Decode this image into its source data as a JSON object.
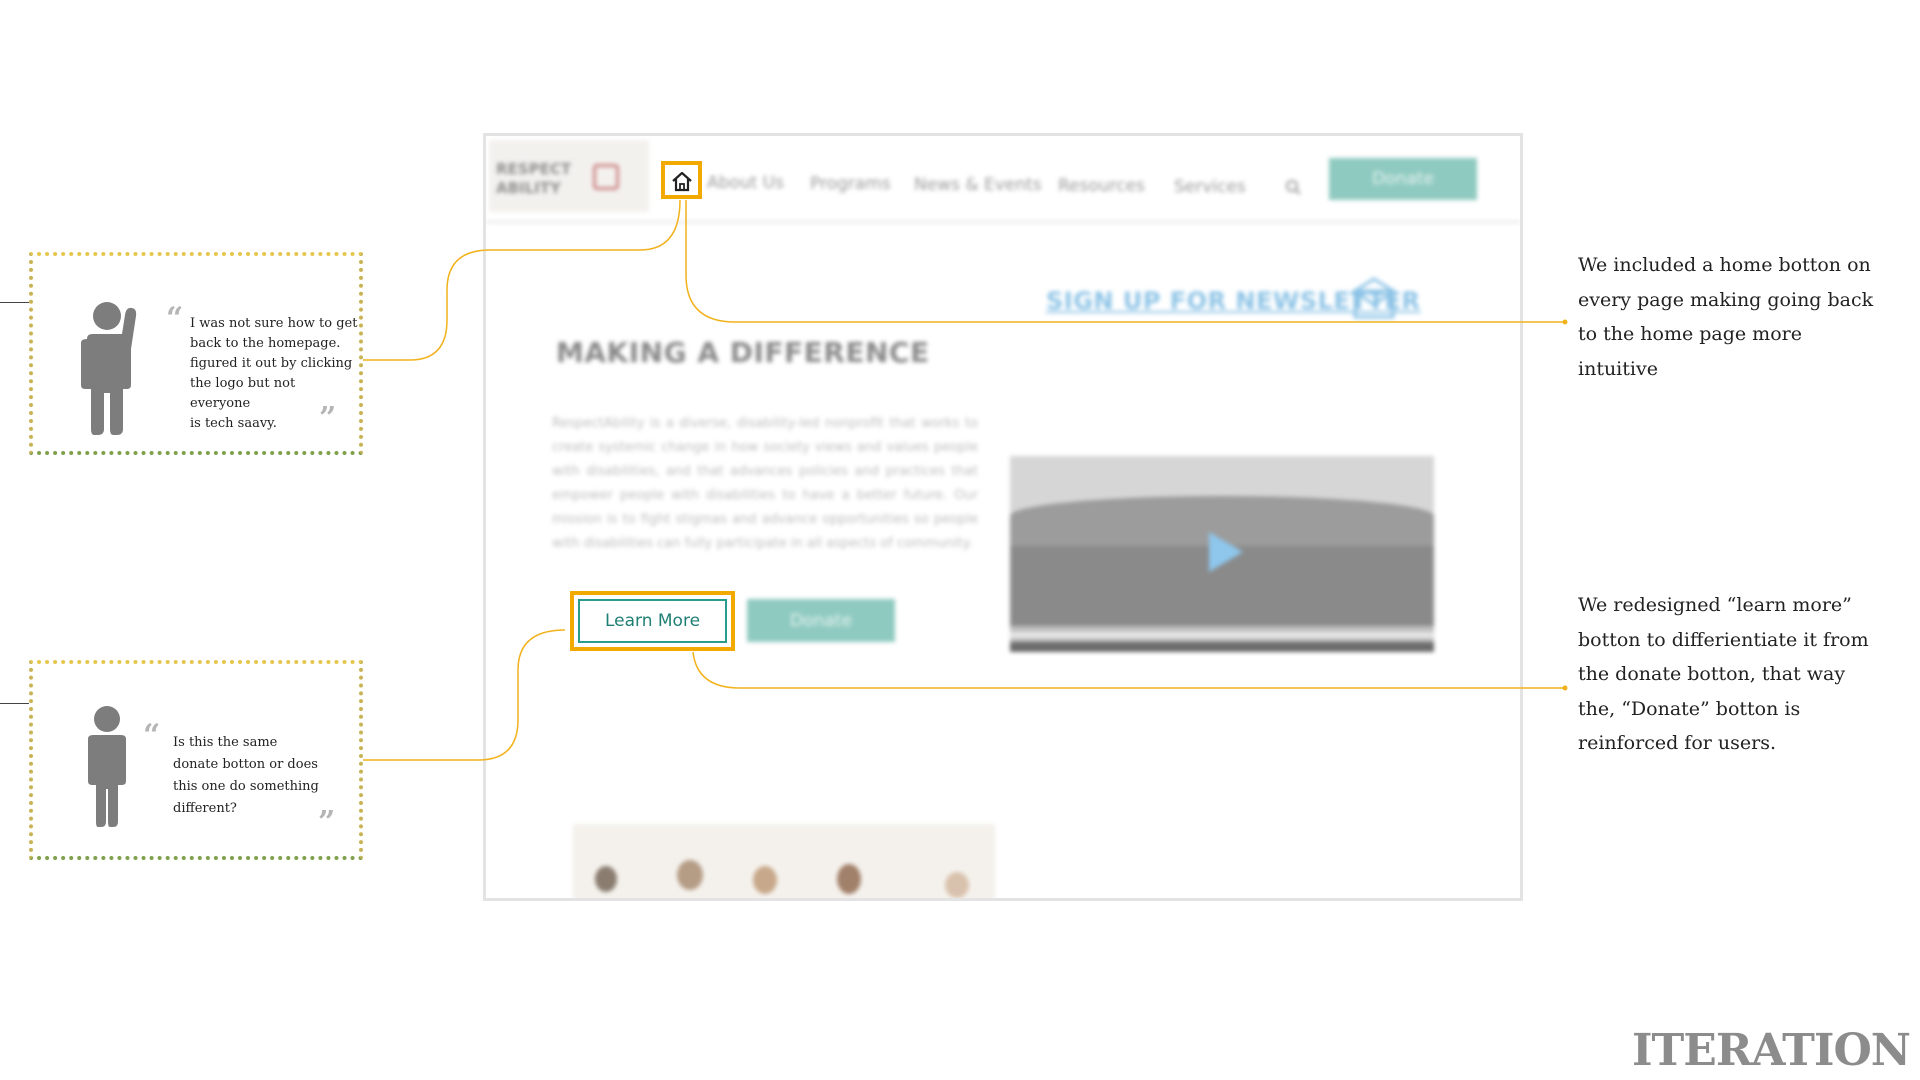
{
  "quotes": [
    {
      "text_lines": [
        "I was not sure how to get",
        "back to the homepage.",
        "figured it out by clicking",
        "the logo but not everyone",
        "is tech saavy."
      ]
    },
    {
      "text_lines": [
        "Is this the same",
        "donate botton or does",
        "this one do something",
        "different?"
      ]
    }
  ],
  "quote_marks": {
    "open": "“",
    "close": "”"
  },
  "mockup": {
    "logo_lines": [
      "RESPECT",
      "ABILITY"
    ],
    "nav": [
      "About Us",
      "Programs",
      "News & Events",
      "Resources",
      "Services"
    ],
    "header_donate": "Donate",
    "newsletter": "SIGN UP FOR NEWSLETTER",
    "heading": "MAKING A DIFFERENCE",
    "paragraph": "RespectAbility is a diverse, disability-led nonprofit that works to create systemic change in how society views and values people with disabilities, and that advances policies and practices that empower people with disabilities to have a better future. Our mission is to fight stigmas and advance opportunities so people with disabilities can fully participate in all aspects of community.",
    "learn_more": "Learn More",
    "hero_donate": "Donate"
  },
  "annotations": [
    {
      "lines": [
        "We included a home botton on",
        "every page making going back",
        "to the home page more",
        "intuitive"
      ]
    },
    {
      "lines": [
        "We redesigned “learn more”",
        "botton to differientiate it from",
        "the donate botton, that way",
        "the, “Donate” botton is",
        "reinforced for users."
      ]
    }
  ],
  "page_title": "ITERATION",
  "colors": {
    "highlight": "#f2a900",
    "teal": "#2a9c8e",
    "donate": "#8fcac0",
    "connector": "#f2b21c",
    "figure": "#7d7d7d"
  },
  "icons": [
    "person-waving-icon",
    "person-standing-icon",
    "home-icon",
    "search-icon",
    "mail-icon",
    "play-icon"
  ]
}
